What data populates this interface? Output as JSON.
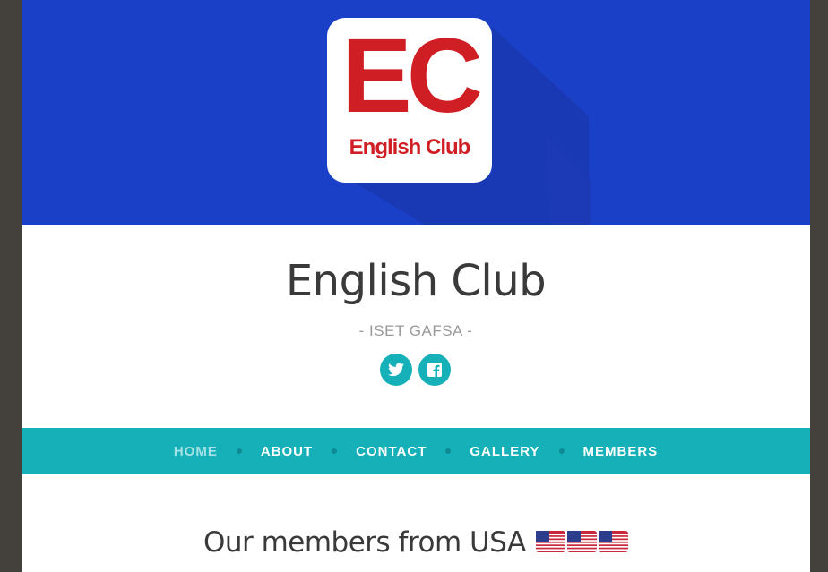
{
  "hero": {
    "logo_letters": "EC",
    "logo_subtitle": "English Club",
    "background_color": "#1b40c8",
    "logo_color": "#d01e25"
  },
  "site": {
    "title": "English Club",
    "tagline": "- ISET GAFSA -"
  },
  "social": [
    {
      "icon": "twitter-icon"
    },
    {
      "icon": "facebook-icon"
    }
  ],
  "nav": {
    "accent_color": "#15b0b8",
    "items": [
      {
        "label": "HOME",
        "active": true
      },
      {
        "label": "ABOUT"
      },
      {
        "label": "CONTACT"
      },
      {
        "label": "GALLERY"
      },
      {
        "label": "MEMBERS"
      }
    ]
  },
  "content": {
    "heading": "Our members from USA",
    "flags": [
      "us-flag-icon",
      "us-flag-icon",
      "us-flag-icon"
    ]
  }
}
